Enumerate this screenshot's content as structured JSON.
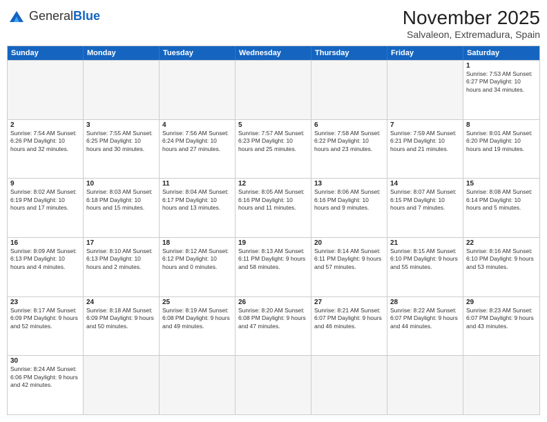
{
  "logo": {
    "text_general": "General",
    "text_blue": "Blue"
  },
  "header": {
    "month": "November 2025",
    "location": "Salvaleon, Extremadura, Spain"
  },
  "weekdays": [
    "Sunday",
    "Monday",
    "Tuesday",
    "Wednesday",
    "Thursday",
    "Friday",
    "Saturday"
  ],
  "weeks": [
    [
      {
        "day": "",
        "empty": true
      },
      {
        "day": "",
        "empty": true
      },
      {
        "day": "",
        "empty": true
      },
      {
        "day": "",
        "empty": true
      },
      {
        "day": "",
        "empty": true
      },
      {
        "day": "",
        "empty": true
      },
      {
        "day": "1",
        "info": "Sunrise: 7:53 AM\nSunset: 6:27 PM\nDaylight: 10 hours and 34 minutes."
      }
    ],
    [
      {
        "day": "2",
        "info": "Sunrise: 7:54 AM\nSunset: 6:26 PM\nDaylight: 10 hours and 32 minutes."
      },
      {
        "day": "3",
        "info": "Sunrise: 7:55 AM\nSunset: 6:25 PM\nDaylight: 10 hours and 30 minutes."
      },
      {
        "day": "4",
        "info": "Sunrise: 7:56 AM\nSunset: 6:24 PM\nDaylight: 10 hours and 27 minutes."
      },
      {
        "day": "5",
        "info": "Sunrise: 7:57 AM\nSunset: 6:23 PM\nDaylight: 10 hours and 25 minutes."
      },
      {
        "day": "6",
        "info": "Sunrise: 7:58 AM\nSunset: 6:22 PM\nDaylight: 10 hours and 23 minutes."
      },
      {
        "day": "7",
        "info": "Sunrise: 7:59 AM\nSunset: 6:21 PM\nDaylight: 10 hours and 21 minutes."
      },
      {
        "day": "8",
        "info": "Sunrise: 8:01 AM\nSunset: 6:20 PM\nDaylight: 10 hours and 19 minutes."
      }
    ],
    [
      {
        "day": "9",
        "info": "Sunrise: 8:02 AM\nSunset: 6:19 PM\nDaylight: 10 hours and 17 minutes."
      },
      {
        "day": "10",
        "info": "Sunrise: 8:03 AM\nSunset: 6:18 PM\nDaylight: 10 hours and 15 minutes."
      },
      {
        "day": "11",
        "info": "Sunrise: 8:04 AM\nSunset: 6:17 PM\nDaylight: 10 hours and 13 minutes."
      },
      {
        "day": "12",
        "info": "Sunrise: 8:05 AM\nSunset: 6:16 PM\nDaylight: 10 hours and 11 minutes."
      },
      {
        "day": "13",
        "info": "Sunrise: 8:06 AM\nSunset: 6:16 PM\nDaylight: 10 hours and 9 minutes."
      },
      {
        "day": "14",
        "info": "Sunrise: 8:07 AM\nSunset: 6:15 PM\nDaylight: 10 hours and 7 minutes."
      },
      {
        "day": "15",
        "info": "Sunrise: 8:08 AM\nSunset: 6:14 PM\nDaylight: 10 hours and 5 minutes."
      }
    ],
    [
      {
        "day": "16",
        "info": "Sunrise: 8:09 AM\nSunset: 6:13 PM\nDaylight: 10 hours and 4 minutes."
      },
      {
        "day": "17",
        "info": "Sunrise: 8:10 AM\nSunset: 6:13 PM\nDaylight: 10 hours and 2 minutes."
      },
      {
        "day": "18",
        "info": "Sunrise: 8:12 AM\nSunset: 6:12 PM\nDaylight: 10 hours and 0 minutes."
      },
      {
        "day": "19",
        "info": "Sunrise: 8:13 AM\nSunset: 6:11 PM\nDaylight: 9 hours and 58 minutes."
      },
      {
        "day": "20",
        "info": "Sunrise: 8:14 AM\nSunset: 6:11 PM\nDaylight: 9 hours and 57 minutes."
      },
      {
        "day": "21",
        "info": "Sunrise: 8:15 AM\nSunset: 6:10 PM\nDaylight: 9 hours and 55 minutes."
      },
      {
        "day": "22",
        "info": "Sunrise: 8:16 AM\nSunset: 6:10 PM\nDaylight: 9 hours and 53 minutes."
      }
    ],
    [
      {
        "day": "23",
        "info": "Sunrise: 8:17 AM\nSunset: 6:09 PM\nDaylight: 9 hours and 52 minutes."
      },
      {
        "day": "24",
        "info": "Sunrise: 8:18 AM\nSunset: 6:09 PM\nDaylight: 9 hours and 50 minutes."
      },
      {
        "day": "25",
        "info": "Sunrise: 8:19 AM\nSunset: 6:08 PM\nDaylight: 9 hours and 49 minutes."
      },
      {
        "day": "26",
        "info": "Sunrise: 8:20 AM\nSunset: 6:08 PM\nDaylight: 9 hours and 47 minutes."
      },
      {
        "day": "27",
        "info": "Sunrise: 8:21 AM\nSunset: 6:07 PM\nDaylight: 9 hours and 46 minutes."
      },
      {
        "day": "28",
        "info": "Sunrise: 8:22 AM\nSunset: 6:07 PM\nDaylight: 9 hours and 44 minutes."
      },
      {
        "day": "29",
        "info": "Sunrise: 8:23 AM\nSunset: 6:07 PM\nDaylight: 9 hours and 43 minutes."
      }
    ],
    [
      {
        "day": "30",
        "info": "Sunrise: 8:24 AM\nSunset: 6:06 PM\nDaylight: 9 hours and 42 minutes."
      },
      {
        "day": "",
        "empty": true
      },
      {
        "day": "",
        "empty": true
      },
      {
        "day": "",
        "empty": true
      },
      {
        "day": "",
        "empty": true
      },
      {
        "day": "",
        "empty": true
      },
      {
        "day": "",
        "empty": true
      }
    ]
  ]
}
